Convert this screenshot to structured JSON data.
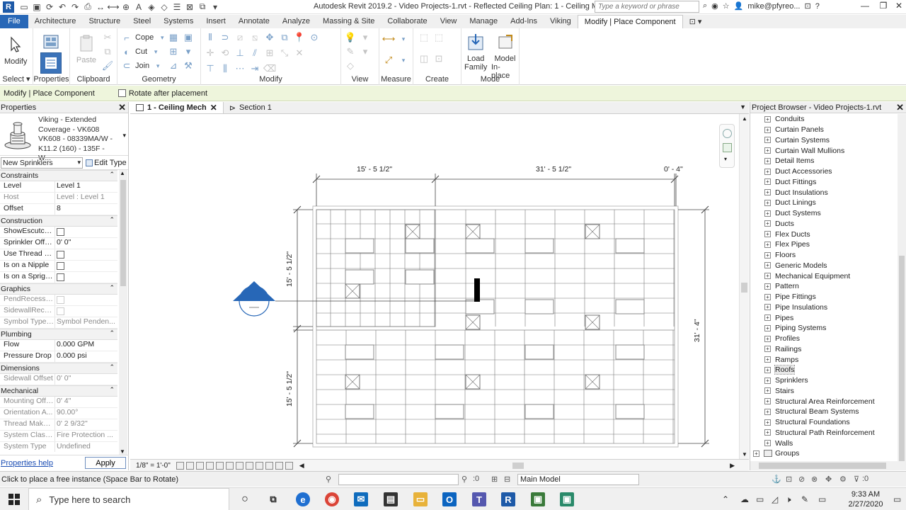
{
  "titlebar": {
    "title": "Autodesk Revit 2019.2 - Video Projects-1.rvt - Reflected Ceiling Plan: 1 - Ceiling Mech",
    "search_placeholder": "Type a keyword or phrase",
    "user": "mike@pfyreo..."
  },
  "ribbon_tabs": [
    "File",
    "Architecture",
    "Structure",
    "Steel",
    "Systems",
    "Insert",
    "Annotate",
    "Analyze",
    "Massing & Site",
    "Collaborate",
    "View",
    "Manage",
    "Add-Ins",
    "Viking",
    "Modify | Place Component"
  ],
  "ribbon": {
    "modify": "Modify",
    "paste": "Paste",
    "cope": "Cope",
    "cut": "Cut",
    "join": "Join",
    "load_family_1": "Load",
    "load_family_2": "Family",
    "model_inplace_1": "Model",
    "model_inplace_2": "In-place",
    "panels": {
      "select": "Select",
      "properties": "Properties",
      "clipboard": "Clipboard",
      "geometry": "Geometry",
      "modify": "Modify",
      "view": "View",
      "measure": "Measure",
      "create": "Create",
      "mode": "Mode"
    }
  },
  "options_bar": {
    "context": "Modify | Place Component",
    "rotate_label": "Rotate after placement"
  },
  "properties": {
    "title": "Properties",
    "type_name": "Viking - Extended Coverage - VK608 VK608 - 08339MA/W - K11.2 (160) - 135F - W...",
    "instance_filter": "New Sprinklers",
    "edit_type": "Edit Type",
    "help": "Properties help",
    "apply": "Apply",
    "categories": {
      "constraints": "Constraints",
      "construction": "Construction",
      "graphics": "Graphics",
      "plumbing": "Plumbing",
      "dimensions": "Dimensions",
      "mechanical": "Mechanical"
    },
    "rows": {
      "level": {
        "k": "Level",
        "v": "Level 1"
      },
      "host": {
        "k": "Host",
        "v": "Level : Level 1"
      },
      "offset": {
        "k": "Offset",
        "v": "8"
      },
      "show_escutcheon": {
        "k": "ShowEscutche..."
      },
      "sprinkler_offset": {
        "k": "Sprinkler Offset",
        "v": "0'  0\""
      },
      "use_thread": {
        "k": "Use Thread M..."
      },
      "on_nipple": {
        "k": "Is on a Nipple"
      },
      "on_sprig": {
        "k": "Is on a Sprig o..."
      },
      "pend_recessed": {
        "k": "PendRecessed..."
      },
      "sidewall_recessed": {
        "k": "SidewallReces..."
      },
      "symbol_type": {
        "k": "Symbol Type<...",
        "v": "Symbol Penden..."
      },
      "flow": {
        "k": "Flow",
        "v": "0.000 GPM"
      },
      "pressure_drop": {
        "k": "Pressure Drop",
        "v": "0.000 psi"
      },
      "sidewall_offset": {
        "k": "Sidewall Offset",
        "v": "0'  0\""
      },
      "mounting_offset": {
        "k": "Mounting Offs...",
        "v": "0'  4\""
      },
      "orientation": {
        "k": "Orientation A...",
        "v": "90.00°"
      },
      "thread_makeup": {
        "k": "Thread Makeup",
        "v": "0'  2 9/32\""
      },
      "system_class": {
        "k": "System Classif...",
        "v": "Fire Protection ..."
      },
      "system_type": {
        "k": "System Type",
        "v": "Undefined"
      }
    }
  },
  "view_tabs": [
    {
      "label": "1 - Ceiling Mech"
    },
    {
      "label": "Section 1"
    }
  ],
  "canvas": {
    "dims": {
      "top_a": "15' - 5 1/2\"",
      "top_b": "31' - 5 1/2\"",
      "top_c": "0' - 4\"",
      "left_a": "15' - 5 1/2\"",
      "left_b": "15' - 5 1/2\"",
      "right": "31' - 4\""
    }
  },
  "view_control": {
    "scale": "1/8\" = 1'-0\""
  },
  "browser": {
    "title": "Project Browser - Video Projects-1.rvt",
    "items": [
      "Conduits",
      "Curtain Panels",
      "Curtain Systems",
      "Curtain Wall Mullions",
      "Detail Items",
      "Duct Accessories",
      "Duct Fittings",
      "Duct Insulations",
      "Duct Linings",
      "Duct Systems",
      "Ducts",
      "Flex Ducts",
      "Flex Pipes",
      "Floors",
      "Generic Models",
      "Mechanical Equipment",
      "Pattern",
      "Pipe Fittings",
      "Pipe Insulations",
      "Pipes",
      "Piping Systems",
      "Profiles",
      "Railings",
      "Ramps",
      "Roofs",
      "Sprinklers",
      "Stairs",
      "Structural Area Reinforcement",
      "Structural Beam Systems",
      "Structural Foundations",
      "Structural Path Reinforcement",
      "Walls"
    ],
    "selected_index": 24,
    "groups": "Groups"
  },
  "status": {
    "message": "Click to place a free instance (Space Bar to Rotate)",
    "zero": ":0",
    "model": "Main Model",
    "filter_count": ":0"
  },
  "taskbar": {
    "search_placeholder": "Type here to search",
    "time": "9:33 AM",
    "date": "2/27/2020"
  },
  "colors": {
    "accent": "#2767b7",
    "options_bar": "#eef5dc"
  }
}
